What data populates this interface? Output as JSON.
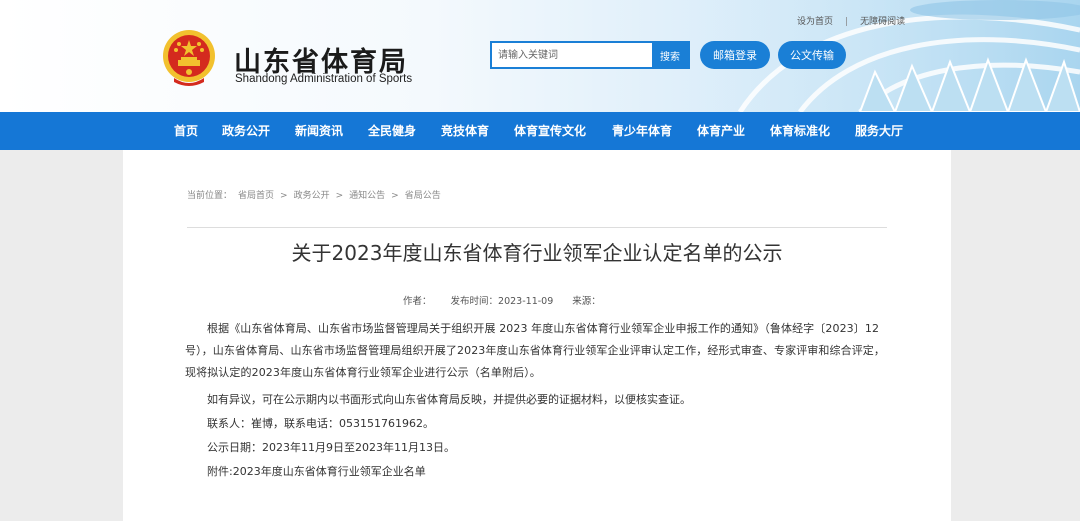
{
  "header": {
    "title": "山东省体育局",
    "subtitle": "Shandong Administration of Sports",
    "top_links": [
      "设为首页",
      "无障碍阅读"
    ],
    "top_sep": "|",
    "search_placeholder": "请输入关键词",
    "search_button": "搜索",
    "buttons": [
      "邮箱登录",
      "公文传输"
    ]
  },
  "nav": {
    "items": [
      "首页",
      "政务公开",
      "新闻资讯",
      "全民健身",
      "竞技体育",
      "体育宣传文化",
      "青少年体育",
      "体育产业",
      "体育标准化",
      "服务大厅"
    ]
  },
  "breadcrumb": {
    "prefix": "当前位置：",
    "items": [
      "省局首页",
      "政务公开",
      "通知公告",
      "省局公告"
    ],
    "sep": ">"
  },
  "article": {
    "title": "关于2023年度山东省体育行业领军企业认定名单的公示",
    "author_label": "作者：",
    "date_label": "发布时间：2023-11-09",
    "source_label": "来源：",
    "paragraphs": [
      "根据《山东省体育局、山东省市场监督管理局关于组织开展 2023 年度山东省体育行业领军企业申报工作的通知》（鲁体经字〔2023〕12号），山东省体育局、山东省市场监督管理局组织开展了2023年度山东省体育行业领军企业评审认定工作，经形式审查、专家评审和综合评定，现将拟认定的2023年度山东省体育行业领军企业进行公示（名单附后）。",
      "如有异议，可在公示期内以书面形式向山东省体育局反映，并提供必要的证据材料，以便核实查证。",
      "联系人：崔博，联系电话：053151761962。",
      "公示日期：2023年11月9日至2023年11月13日。",
      "附件:2023年度山东省体育行业领军企业名单"
    ]
  },
  "colors": {
    "brand_blue": "#1577d6",
    "button_blue": "#1a7fd6",
    "emblem_red": "#d42a1e",
    "emblem_gold": "#f2c12e"
  }
}
